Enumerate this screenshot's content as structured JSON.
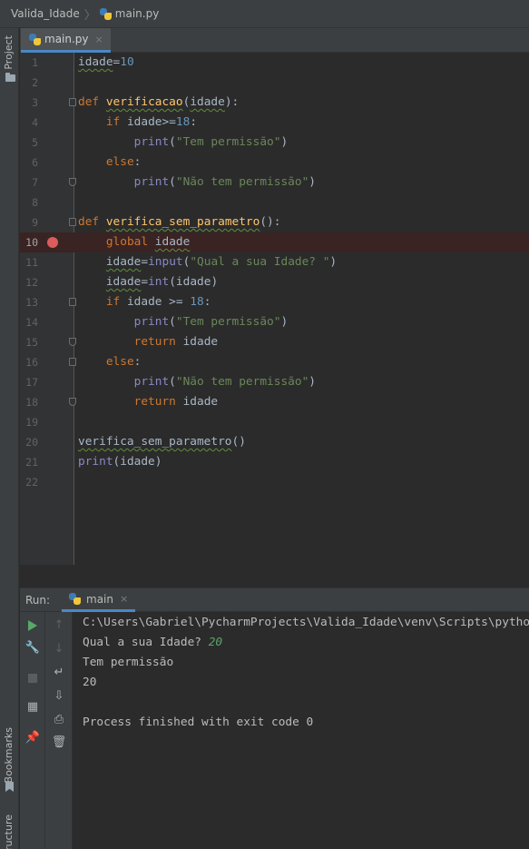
{
  "breadcrumb": {
    "project": "Valida_Idade",
    "file": "main.py"
  },
  "side_tools": {
    "project_label": "Project",
    "bookmarks_label": "Bookmarks",
    "structure_label": "ructure"
  },
  "tab": {
    "label": "main.py",
    "close": "×"
  },
  "editor": {
    "line_numbers": [
      "1",
      "2",
      "3",
      "4",
      "5",
      "6",
      "7",
      "8",
      "9",
      "10",
      "11",
      "12",
      "13",
      "14",
      "15",
      "16",
      "17",
      "18",
      "19",
      "20",
      "21",
      "22"
    ],
    "breakpoint_line": 10,
    "code": {
      "l1": {
        "var": "idade",
        "eq": "=",
        "val": "10"
      },
      "l3": {
        "kw": "def",
        "name": "verificacao",
        "open": "(",
        "param": "idade",
        "close": "):"
      },
      "l4": {
        "kw": "if",
        "var": "idade",
        "op": ">=",
        "val": "18",
        "colon": ":"
      },
      "l5": {
        "fn": "print",
        "open": "(",
        "str": "\"Tem permissão\"",
        "close": ")"
      },
      "l6": {
        "kw": "else",
        "colon": ":"
      },
      "l7": {
        "fn": "print",
        "open": "(",
        "str": "\"Não tem permissão\"",
        "close": ")"
      },
      "l9": {
        "kw": "def",
        "name": "verifica_sem_parametro",
        "paren": "():"
      },
      "l10": {
        "kw": "global",
        "var": "idade"
      },
      "l11": {
        "var": "idade",
        "eq": "=",
        "fn": "input",
        "open": "(",
        "str": "\"Qual a sua Idade? \"",
        "close": ")"
      },
      "l12": {
        "var": "idade",
        "eq": "=",
        "fn": "int",
        "open": "(",
        "arg": "idade",
        "close": ")"
      },
      "l13": {
        "kw": "if",
        "expr": " idade >= ",
        "val": "18",
        "colon": ":"
      },
      "l14": {
        "fn": "print",
        "open": "(",
        "str": "\"Tem permissão\"",
        "close": ")"
      },
      "l15": {
        "kw": "return",
        "var": "idade"
      },
      "l16": {
        "kw": "else",
        "colon": ":"
      },
      "l17": {
        "fn": "print",
        "open": "(",
        "str": "\"Não tem permissão\"",
        "close": ")"
      },
      "l18": {
        "kw": "return",
        "var": "idade"
      },
      "l20": {
        "call": "verifica_sem_parametro",
        "paren": "()"
      },
      "l21": {
        "fn": "print",
        "rest": "(idade)"
      }
    }
  },
  "run": {
    "label": "Run:",
    "config": "main",
    "close": "×",
    "toolbar": {
      "run_icon": "play-icon",
      "settings_icon": "wrench-icon",
      "stop_icon": "stop-icon",
      "layout_icon": "layout-icon",
      "pin_icon": "pin-icon",
      "up_icon": "arrow-up-icon",
      "down_icon": "arrow-down-icon",
      "wrap_icon": "soft-wrap-icon",
      "scroll_icon": "scroll-to-end-icon",
      "print_icon": "print-icon",
      "trash_icon": "trash-icon"
    },
    "console": {
      "cmd": "C:\\Users\\Gabriel\\PycharmProjects\\Valida_Idade\\venv\\Scripts\\python.exe",
      "prompt": "Qual a sua Idade? ",
      "user_input": "20",
      "out1": "Tem permissão",
      "out2": "20",
      "finished": "Process finished with exit code 0"
    }
  },
  "colors": {
    "keyword": "#cc7832",
    "function": "#ffc66d",
    "string": "#6a8759",
    "number": "#6897bb",
    "builtin": "#8888c6",
    "breakpoint": "#db5c5c",
    "accent": "#4a88c7"
  }
}
